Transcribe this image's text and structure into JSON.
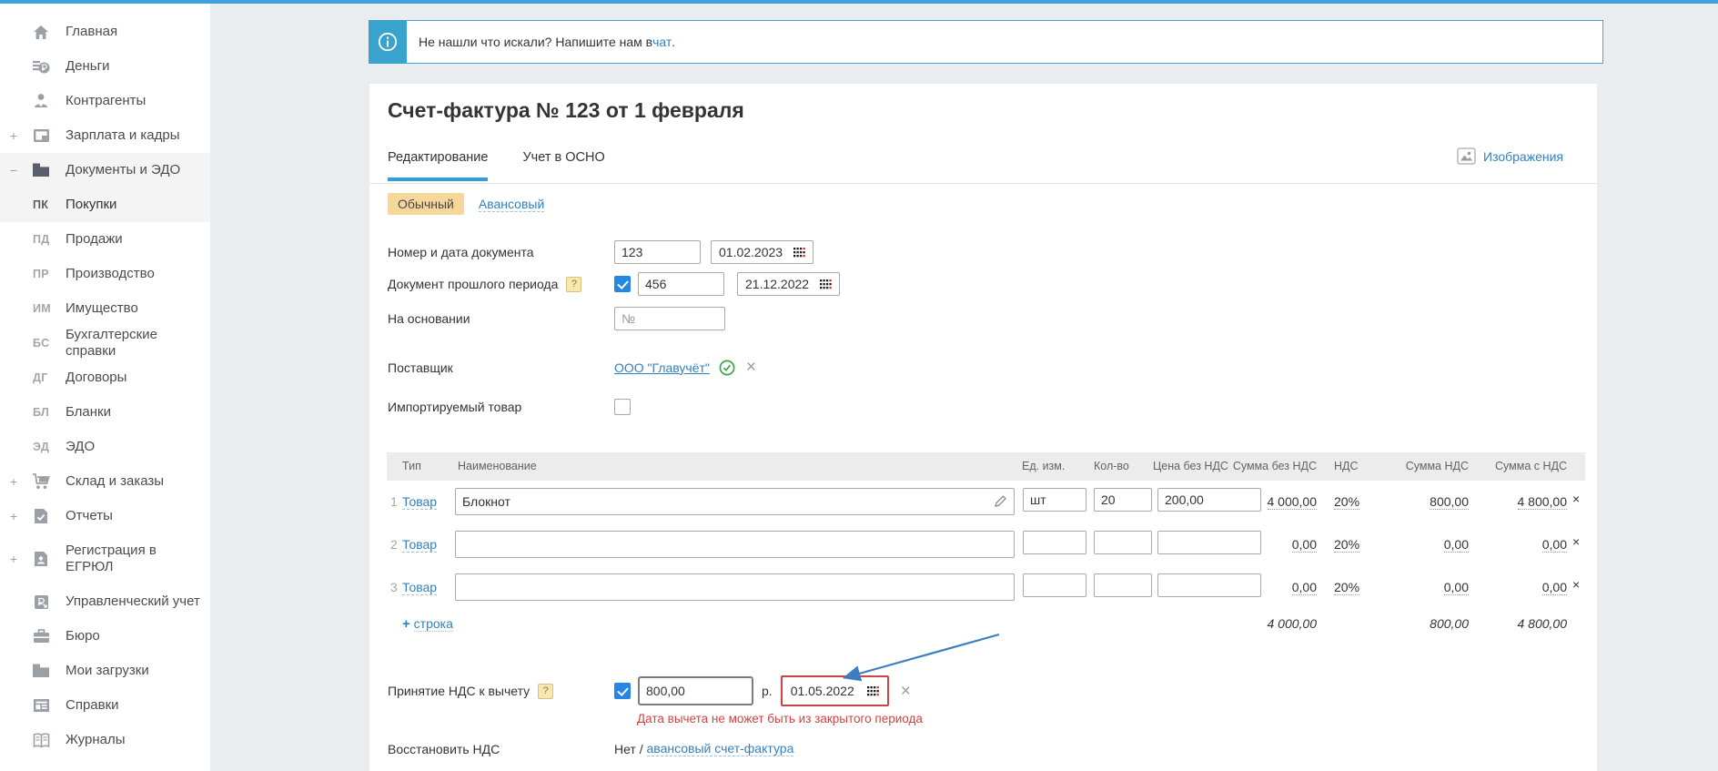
{
  "colors": {
    "accent_bar": "#3fa2dc",
    "banner_icon_bg": "#38a3cd",
    "link": "#3380bf",
    "tab_underline": "#2ea0d8",
    "badge_bg": "#f6d79b",
    "checkbox_blue": "#2586e3",
    "error_red": "#d14343",
    "green_check": "#3aa54a",
    "annotation_arrow": "#3d7ec2"
  },
  "sidebar": {
    "items": [
      {
        "icon": "home-icon",
        "label": "Главная"
      },
      {
        "icon": "money-icon",
        "label": "Деньги"
      },
      {
        "icon": "contractors-icon",
        "label": "Контрагенты"
      },
      {
        "icon": "salary-icon",
        "label": "Зарплата и кадры",
        "expand": "+"
      },
      {
        "icon": "documents-icon",
        "label": "Документы и ЭДО",
        "expand": "−",
        "active": true
      },
      {
        "prefix": "ПК",
        "label": "Покупки",
        "selected": true
      },
      {
        "prefix": "ПД",
        "label": "Продажи"
      },
      {
        "prefix": "ПР",
        "label": "Производство"
      },
      {
        "prefix": "ИМ",
        "label": "Имущество"
      },
      {
        "prefix": "БС",
        "label": "Бухгалтерские справки"
      },
      {
        "prefix": "ДГ",
        "label": "Договоры"
      },
      {
        "prefix": "БЛ",
        "label": "Бланки"
      },
      {
        "prefix": "ЭД",
        "label": "ЭДО"
      },
      {
        "icon": "warehouse-icon",
        "label": "Склад и заказы",
        "expand": "+"
      },
      {
        "icon": "reports-icon",
        "label": "Отчеты",
        "expand": "+"
      },
      {
        "icon": "registration-icon",
        "label": "Регистрация в ЕГРЮЛ",
        "expand": "+",
        "twoline": true
      },
      {
        "icon": "management-icon",
        "label": "Управленческий учет"
      },
      {
        "icon": "bureau-icon",
        "label": "Бюро"
      },
      {
        "icon": "downloads-icon",
        "label": "Мои загрузки"
      },
      {
        "icon": "certificates-icon",
        "label": "Справки"
      },
      {
        "icon": "journals-icon",
        "label": "Журналы"
      }
    ]
  },
  "banner": {
    "text_before": "Не нашли что искали? Напишите нам в ",
    "link_text": "чат",
    "text_after": "."
  },
  "header": {
    "title": "Счет-фактура № 123 от 1 февраля",
    "tab_edit": "Редактирование",
    "tab_osno": "Учет в ОСНО",
    "images_link": "Изображения"
  },
  "type_toggle": {
    "selected": "Обычный",
    "alternative": "Авансовый"
  },
  "form": {
    "number_date_label": "Номер и дата документа",
    "doc_number": "123",
    "doc_date": "01.02.2023",
    "past_period_label": "Документ прошлого периода",
    "past_checked": true,
    "past_number": "456",
    "past_date": "21.12.2022",
    "basis_label": "На основании",
    "basis_placeholder": "№",
    "supplier_label": "Поставщик",
    "supplier_name": "ООО \"Главучёт\"",
    "import_label": "Импортируемый товар",
    "import_checked": false
  },
  "table": {
    "headers": [
      "Тип",
      "Наименование",
      "Ед. изм.",
      "Кол-во",
      "Цена без НДС",
      "Сумма без НДС",
      "НДС",
      "Сумма НДС",
      "Сумма с НДС"
    ],
    "rows": [
      {
        "num": "1",
        "type": "Товар",
        "name": "Блокнот",
        "unit": "шт",
        "qty": "20",
        "price": "200,00",
        "sum_no_vat": "4 000,00",
        "vat": "20%",
        "vat_sum": "800,00",
        "sum_with_vat": "4 800,00",
        "filled": true
      },
      {
        "num": "2",
        "type": "Товар",
        "name": "",
        "unit": "",
        "qty": "",
        "price": "",
        "sum_no_vat": "0,00",
        "vat": "20%",
        "vat_sum": "0,00",
        "sum_with_vat": "0,00",
        "filled": false
      },
      {
        "num": "3",
        "type": "Товар",
        "name": "",
        "unit": "",
        "qty": "",
        "price": "",
        "sum_no_vat": "0,00",
        "vat": "20%",
        "vat_sum": "0,00",
        "sum_with_vat": "0,00",
        "filled": false
      }
    ],
    "add_row_plus": "+",
    "add_row_label": "строка",
    "totals": {
      "sum_no_vat": "4 000,00",
      "vat_sum": "800,00",
      "sum_with_vat": "4 800,00"
    }
  },
  "vat_deduction": {
    "label": "Принятие НДС к вычету",
    "checked": true,
    "amount": "800,00",
    "currency": "р.",
    "date": "01.05.2022",
    "error": "Дата вычета не может быть из закрытого периода"
  },
  "vat_restore": {
    "label": "Восстановить НДС",
    "value_prefix": "Нет / ",
    "link_text": "авансовый счет-фактура"
  }
}
